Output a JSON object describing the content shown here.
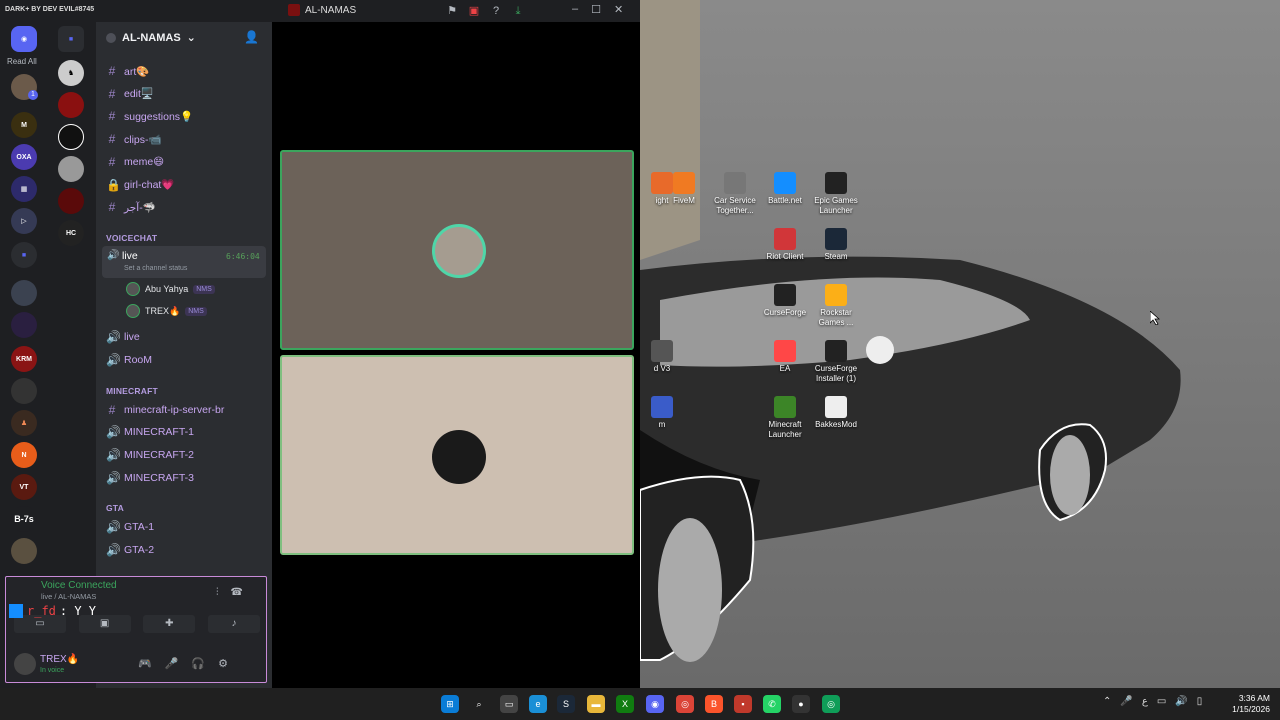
{
  "window": {
    "mod_label": "DARK+ BY DEV EVIL#8745",
    "title": "AL-NAMAS"
  },
  "rail": {
    "read_all": "Read All",
    "badge_count": "1",
    "server_labels": [
      "B-7s"
    ]
  },
  "server": {
    "name": "AL-NAMAS"
  },
  "channels": {
    "text": [
      {
        "name": "art🎨",
        "icon": "hash-icon"
      },
      {
        "name": "edit🖥️",
        "icon": "hash-icon"
      },
      {
        "name": "suggestions💡",
        "icon": "hash-icon"
      },
      {
        "name": "clips-📹",
        "icon": "hash-icon"
      },
      {
        "name": "meme😄",
        "icon": "hash-icon"
      },
      {
        "name": "girl-chat💗",
        "icon": "lock-icon"
      },
      {
        "name": "آجر-🦈",
        "icon": "hash-icon"
      }
    ],
    "voicechat_label": "VOICECHAT",
    "live_channel": {
      "name": "live",
      "timer": "6:46:04",
      "status": "Set a channel status"
    },
    "voice_users": [
      {
        "name": "Abu Yahya",
        "tag": "NMS"
      },
      {
        "name": "TREX🔥",
        "tag": "NMS"
      }
    ],
    "more_voice": [
      "live",
      "RooM"
    ],
    "minecraft_label": "MINECRAFT",
    "minecraft": [
      "minecraft-ip-server-br",
      "MINECRAFT-1",
      "MINECRAFT-2",
      "MINECRAFT-3"
    ],
    "gta_label": "GTA",
    "gta": [
      "GTA-1",
      "GTA-2"
    ]
  },
  "voice_panel": {
    "title": "Voice Connected",
    "subtitle": "live / AL-NAMAS",
    "overlay_text": ": Y Y",
    "overlay_red": "r_fd"
  },
  "user": {
    "name": "TREX🔥",
    "status": "In voice"
  },
  "desktop_icons": [
    {
      "label": "ight",
      "color": "#e86a2a"
    },
    {
      "label": "FiveM",
      "color": "#f07a22"
    },
    {
      "label": "Car Service Together...",
      "color": "#777777"
    },
    {
      "label": "Battle.net",
      "color": "#148eff"
    },
    {
      "label": "Epic Games Launcher",
      "color": "#222222"
    },
    {
      "label": "Riot Client",
      "color": "#d13639"
    },
    {
      "label": "Steam",
      "color": "#1b2838"
    },
    {
      "label": "CurseForge",
      "color": "#222222"
    },
    {
      "label": "Rockstar Games ...",
      "color": "#fcaf17"
    },
    {
      "label": "d V3",
      "color": "#555555"
    },
    {
      "label": "EA",
      "color": "#ff4747"
    },
    {
      "label": "CurseForge Installer (1)",
      "color": "#222222"
    },
    {
      "label": "m",
      "color": "#3a5cc9"
    },
    {
      "label": "Minecraft Launcher",
      "color": "#3c8527"
    },
    {
      "label": "BakkesMod",
      "color": "#eeeeee"
    }
  ],
  "clock": {
    "time": "3:36 AM",
    "date": "1/15/2026"
  }
}
